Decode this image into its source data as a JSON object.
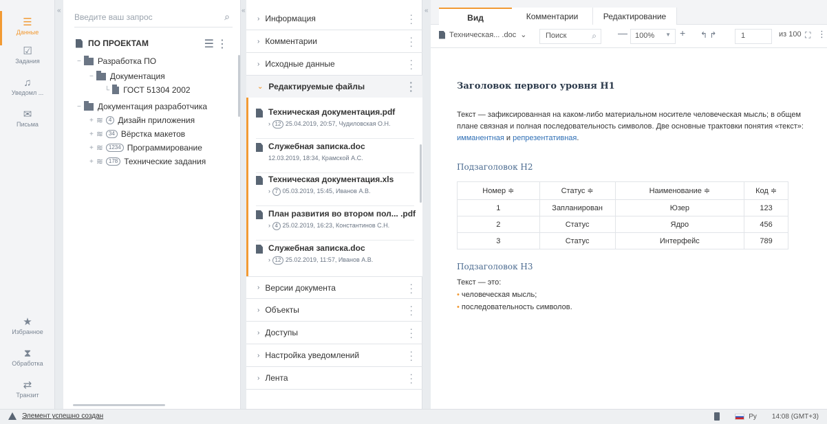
{
  "rail": {
    "items": [
      {
        "label": "Данные",
        "icon": "menu-icon"
      },
      {
        "label": "Задания",
        "icon": "task-icon"
      },
      {
        "label": "Уведомл ...",
        "icon": "bell-icon"
      },
      {
        "label": "Письма",
        "icon": "mail-icon"
      },
      {
        "label": "Избранное",
        "icon": "star-icon"
      },
      {
        "label": "Обработка",
        "icon": "hourglass-icon"
      },
      {
        "label": "Транзит",
        "icon": "transfer-icon"
      }
    ],
    "accent": "#f29a33"
  },
  "tree": {
    "search_placeholder": "Введите ваш запрос",
    "title": "ПО ПРОЕКТАМ",
    "nodes": [
      {
        "label": "Разработка ПО"
      },
      {
        "label": "Документация"
      },
      {
        "label": "ГОСТ 51304  2002"
      },
      {
        "label": "Документация разработчика"
      },
      {
        "label": "Дизайн приложения",
        "count": "4"
      },
      {
        "label": "Вёрстка макетов",
        "count": "34"
      },
      {
        "label": "Программирование",
        "count": "1234"
      },
      {
        "label": "Технические задания",
        "count": "178"
      }
    ]
  },
  "sections": {
    "top": [
      {
        "label": "Информация"
      },
      {
        "label": "Комментарии"
      },
      {
        "label": "Исходные данные"
      }
    ],
    "open": {
      "label": "Редактируемые файлы"
    },
    "bottom": [
      {
        "label": "Версии документа"
      },
      {
        "label": "Объекты"
      },
      {
        "label": "Доступы"
      },
      {
        "label": "Настройка уведомлений"
      },
      {
        "label": "Лента"
      }
    ]
  },
  "files": [
    {
      "name": "Техническая документация.pdf",
      "count": "12",
      "date": "25.04.2019, 20:57, Чудиловская О.Н."
    },
    {
      "name": "Служебная записка.doc",
      "count": "",
      "date": "12.03.2019, 18:34, Крамской А.С."
    },
    {
      "name": "Техническая документация.xls",
      "count": "7",
      "date": "05.03.2019, 15:45, Иванов А.В."
    },
    {
      "name": "План развития во втором пол... .pdf",
      "count": "4",
      "date": "25.02.2019, 16:23, Константинов С.Н."
    },
    {
      "name": "Служебная записка.doc",
      "count": "12",
      "date": "25.02.2019, 11:57, Иванов А.В."
    }
  ],
  "viewer": {
    "tabs": [
      {
        "label": "Вид"
      },
      {
        "label": "Комментарии"
      },
      {
        "label": "Редактирование"
      }
    ],
    "toolbar": {
      "doc_name": "Техническая... .doc",
      "search": "Поиск",
      "zoom": "100%",
      "page": "1",
      "of": "из 100"
    },
    "doc": {
      "h1": "Заголовок первого уровня H1",
      "p_before": "Текст — зафиксированная на каком-либо материальном носителе человеческая мысль; в общем плане связная и полная последовательность символов. Две основные трактовки понятия «текст»: ",
      "link1": "имманентная",
      "p_and": " и ",
      "link2": "репрезентативная",
      "p_end": ".",
      "h2": "Подзаголовок H2",
      "table": {
        "headers": [
          "Номер ≑",
          "Статус ≑",
          "Наименование ≑",
          "Код ≑"
        ],
        "rows": [
          [
            "1",
            "Запланирован",
            "Юзер",
            "123"
          ],
          [
            "2",
            "Статус",
            "Ядро",
            "456"
          ],
          [
            "3",
            "Статус",
            "Интерфейс",
            "789"
          ]
        ]
      },
      "h3": "Подзаголовок H3",
      "p2": "Текст — это:",
      "list": [
        "человеческая мысль;",
        "последовательность символов."
      ]
    }
  },
  "status": {
    "message": "Элемент успешно создан",
    "lang": "Ру",
    "time": "14:08 (GMT+3)"
  }
}
